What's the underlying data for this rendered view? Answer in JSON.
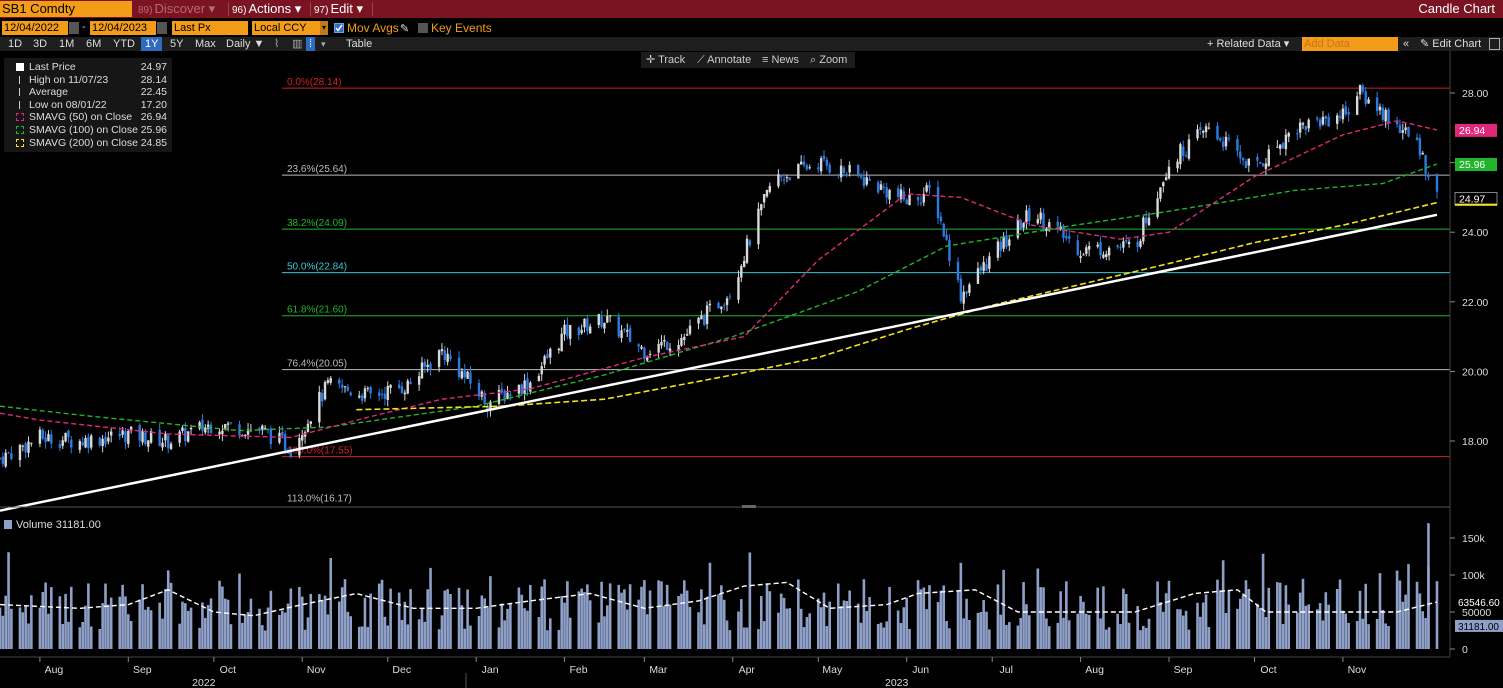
{
  "header": {
    "ticker": "SB1 Comdty",
    "discover": {
      "num": "89)",
      "label": "Discover"
    },
    "actions": {
      "num": "96)",
      "label": "Actions"
    },
    "edit": {
      "num": "97)",
      "label": "Edit"
    },
    "title": "Candle Chart"
  },
  "controls": {
    "start_date": "12/04/2022",
    "end_date": "12/04/2023",
    "field": "Last Px",
    "currency": "Local CCY",
    "mov_avgs": "Mov Avgs",
    "key_events": "Key Events"
  },
  "periods": [
    "1D",
    "3D",
    "1M",
    "6M",
    "YTD",
    "1Y",
    "5Y",
    "Max"
  ],
  "selected_period": "1Y",
  "frequency": "Daily",
  "table_label": "Table",
  "related_data": "Related Data",
  "add_data_placeholder": "Add Data",
  "edit_chart": "Edit Chart",
  "tools": {
    "track": "Track",
    "annotate": "Annotate",
    "news": "News",
    "zoom": "Zoom"
  },
  "legend": [
    {
      "label": "Last Price",
      "value": "24.97",
      "color": "#ffffff"
    },
    {
      "label": "High on 11/07/23",
      "value": "28.14",
      "color": "#cccccc"
    },
    {
      "label": "Average",
      "value": "22.45",
      "color": "#cccccc"
    },
    {
      "label": "Low on 08/01/22",
      "value": "17.20",
      "color": "#cccccc"
    },
    {
      "label": "SMAVG (50)  on Close",
      "value": "26.94",
      "color": "#e0287a"
    },
    {
      "label": "SMAVG (100)  on Close",
      "value": "25.96",
      "color": "#21b32a"
    },
    {
      "label": "SMAVG (200)  on Close",
      "value": "24.85",
      "color": "#f2e21a"
    }
  ],
  "volume_legend": "Volume 31181.00",
  "colors": {
    "up": "#d9d9d9",
    "down": "#2d7be0",
    "sma50": "#e0287a",
    "sma100": "#21b32a",
    "sma200": "#f2e21a",
    "accent": "#f29c1a",
    "header": "#7a1422"
  },
  "chart_data": [
    {
      "type": "candlestick",
      "title": "SB1 Comdty",
      "ylim": [
        16,
        28.7
      ],
      "yticks": [
        18.0,
        20.0,
        22.0,
        24.0,
        26.0,
        28.0
      ],
      "ytick_labels": [
        "18.00",
        "20.00",
        "22.00",
        "24.00",
        "26.00",
        "28.00"
      ],
      "x_range": [
        "2022-07-18",
        "2023-12-04"
      ],
      "months": [
        {
          "label": "Aug",
          "date": "2022-08-01"
        },
        {
          "label": "Sep",
          "date": "2022-09-01"
        },
        {
          "label": "Oct",
          "date": "2022-10-01"
        },
        {
          "label": "Nov",
          "date": "2022-11-01"
        },
        {
          "label": "Dec",
          "date": "2022-12-01"
        },
        {
          "label": "Jan",
          "date": "2023-01-01"
        },
        {
          "label": "Feb",
          "date": "2023-02-01"
        },
        {
          "label": "Mar",
          "date": "2023-03-01"
        },
        {
          "label": "Apr",
          "date": "2023-04-01"
        },
        {
          "label": "May",
          "date": "2023-05-01"
        },
        {
          "label": "Jun",
          "date": "2023-06-01"
        },
        {
          "label": "Jul",
          "date": "2023-07-01"
        },
        {
          "label": "Aug",
          "date": "2023-08-01"
        },
        {
          "label": "Sep",
          "date": "2023-09-01"
        },
        {
          "label": "Oct",
          "date": "2023-10-01"
        },
        {
          "label": "Nov",
          "date": "2023-11-01"
        }
      ],
      "years": [
        {
          "label": "2022",
          "date": "2022-10-01"
        },
        {
          "label": "2023",
          "date": "2023-06-01"
        }
      ],
      "close_path": [
        [
          "2022-07-18",
          17.5
        ],
        [
          "2022-08-01",
          18.1
        ],
        [
          "2022-08-15",
          18.0
        ],
        [
          "2022-09-01",
          18.2
        ],
        [
          "2022-09-15",
          18.0
        ],
        [
          "2022-10-01",
          18.5
        ],
        [
          "2022-10-18",
          18.3
        ],
        [
          "2022-10-28",
          17.8
        ],
        [
          "2022-11-10",
          19.6
        ],
        [
          "2022-11-25",
          19.3
        ],
        [
          "2022-12-08",
          19.6
        ],
        [
          "2022-12-20",
          20.6
        ],
        [
          "2023-01-05",
          19.1
        ],
        [
          "2023-01-20",
          19.7
        ],
        [
          "2023-02-01",
          21.1
        ],
        [
          "2023-02-15",
          21.5
        ],
        [
          "2023-03-01",
          20.6
        ],
        [
          "2023-03-15",
          21.0
        ],
        [
          "2023-03-31",
          22.3
        ],
        [
          "2023-04-15",
          25.5
        ],
        [
          "2023-05-01",
          26.0
        ],
        [
          "2023-05-15",
          25.6
        ],
        [
          "2023-06-01",
          24.9
        ],
        [
          "2023-06-10",
          25.2
        ],
        [
          "2023-06-20",
          22.2
        ],
        [
          "2023-07-01",
          23.3
        ],
        [
          "2023-07-15",
          24.6
        ],
        [
          "2023-08-01",
          23.5
        ],
        [
          "2023-08-20",
          23.6
        ],
        [
          "2023-09-01",
          26.0
        ],
        [
          "2023-09-15",
          27.0
        ],
        [
          "2023-10-01",
          25.8
        ],
        [
          "2023-10-15",
          27.0
        ],
        [
          "2023-11-01",
          27.4
        ],
        [
          "2023-11-07",
          28.0
        ],
        [
          "2023-11-20",
          27.1
        ],
        [
          "2023-11-28",
          26.4
        ],
        [
          "2023-12-04",
          24.97
        ]
      ],
      "sma50": [
        [
          "2022-07-18",
          18.8
        ],
        [
          "2022-08-01",
          18.6
        ],
        [
          "2022-09-15",
          18.2
        ],
        [
          "2022-10-28",
          18.1
        ],
        [
          "2022-11-25",
          18.7
        ],
        [
          "2022-12-20",
          19.2
        ],
        [
          "2023-01-20",
          19.5
        ],
        [
          "2023-03-01",
          20.4
        ],
        [
          "2023-04-05",
          21.0
        ],
        [
          "2023-05-01",
          23.2
        ],
        [
          "2023-06-01",
          25.1
        ],
        [
          "2023-06-20",
          25.0
        ],
        [
          "2023-07-15",
          24.2
        ],
        [
          "2023-08-15",
          23.8
        ],
        [
          "2023-09-01",
          24.0
        ],
        [
          "2023-10-01",
          25.6
        ],
        [
          "2023-11-01",
          26.8
        ],
        [
          "2023-11-20",
          27.2
        ],
        [
          "2023-12-04",
          26.94
        ]
      ],
      "sma100": [
        [
          "2022-07-18",
          19.0
        ],
        [
          "2022-08-20",
          18.7
        ],
        [
          "2022-10-10",
          18.3
        ],
        [
          "2022-11-10",
          18.4
        ],
        [
          "2023-01-01",
          19.0
        ],
        [
          "2023-02-15",
          19.9
        ],
        [
          "2023-04-01",
          21.0
        ],
        [
          "2023-05-15",
          22.3
        ],
        [
          "2023-06-15",
          23.6
        ],
        [
          "2023-07-30",
          24.2
        ],
        [
          "2023-09-01",
          24.6
        ],
        [
          "2023-10-15",
          25.2
        ],
        [
          "2023-11-15",
          25.4
        ],
        [
          "2023-12-04",
          25.96
        ]
      ],
      "sma200": [
        [
          "2022-11-20",
          18.9
        ],
        [
          "2023-01-10",
          19.0
        ],
        [
          "2023-02-15",
          19.2
        ],
        [
          "2023-04-01",
          19.9
        ],
        [
          "2023-05-01",
          20.4
        ],
        [
          "2023-06-01",
          21.2
        ],
        [
          "2023-07-01",
          21.9
        ],
        [
          "2023-08-01",
          22.5
        ],
        [
          "2023-09-01",
          23.1
        ],
        [
          "2023-10-01",
          23.7
        ],
        [
          "2023-11-01",
          24.2
        ],
        [
          "2023-12-04",
          24.85
        ]
      ],
      "trendline": [
        [
          "2022-07-18",
          16.0
        ],
        [
          "2023-12-04",
          24.5
        ]
      ],
      "fib_levels": [
        {
          "label": "0.0%(28.14)",
          "value": 28.14,
          "color": "#d2202b"
        },
        {
          "label": "23.6%(25.64)",
          "value": 25.64,
          "color": "#bbbbbb"
        },
        {
          "label": "38.2%(24.09)",
          "value": 24.09,
          "color": "#21b32a"
        },
        {
          "label": "50.0%(22.84)",
          "value": 22.84,
          "color": "#3cc6d6"
        },
        {
          "label": "61.8%(21.60)",
          "value": 21.6,
          "color": "#21b32a"
        },
        {
          "label": "76.4%(20.05)",
          "value": 20.05,
          "color": "#bbbbbb"
        },
        {
          "label": "100.0%(17.55)",
          "value": 17.55,
          "color": "#d2202b"
        },
        {
          "label": "113.0%(16.17)",
          "value": 16.17,
          "color": "#bbbbbb"
        }
      ],
      "last_labels": [
        {
          "label": "26.94",
          "value": 26.94,
          "bg": "#e0287a",
          "fg": "#ffffff"
        },
        {
          "label": "25.96",
          "value": 25.96,
          "bg": "#21b32a",
          "fg": "#ffffff"
        },
        {
          "label": "24.97",
          "value": 24.97,
          "bg": "#000000",
          "fg": "#ffffff"
        }
      ]
    },
    {
      "type": "bar",
      "title": "Volume",
      "ylim": [
        0,
        180000
      ],
      "yticks": [
        0,
        50000,
        100000,
        150000
      ],
      "ytick_labels": [
        "0",
        "50000",
        "100k",
        "150k"
      ],
      "avg_path": [
        [
          "2022-07-18",
          60000
        ],
        [
          "2022-08-15",
          55000
        ],
        [
          "2022-09-01",
          60000
        ],
        [
          "2022-09-15",
          80000
        ],
        [
          "2022-10-01",
          50000
        ],
        [
          "2022-10-15",
          45000
        ],
        [
          "2022-11-01",
          60000
        ],
        [
          "2022-11-20",
          75000
        ],
        [
          "2022-12-10",
          55000
        ],
        [
          "2023-01-01",
          55000
        ],
        [
          "2023-01-20",
          65000
        ],
        [
          "2023-02-10",
          75000
        ],
        [
          "2023-03-01",
          55000
        ],
        [
          "2023-03-20",
          65000
        ],
        [
          "2023-04-05",
          85000
        ],
        [
          "2023-04-20",
          90000
        ],
        [
          "2023-05-05",
          55000
        ],
        [
          "2023-05-25",
          60000
        ],
        [
          "2023-06-05",
          75000
        ],
        [
          "2023-06-25",
          80000
        ],
        [
          "2023-07-10",
          50000
        ],
        [
          "2023-08-01",
          50000
        ],
        [
          "2023-08-20",
          50000
        ],
        [
          "2023-09-10",
          75000
        ],
        [
          "2023-09-25",
          80000
        ],
        [
          "2023-10-05",
          50000
        ],
        [
          "2023-11-01",
          50000
        ],
        [
          "2023-11-20",
          50000
        ],
        [
          "2023-12-04",
          63546
        ]
      ],
      "last_labels": [
        {
          "label": "63546.60",
          "value": 63546,
          "bg": "#000000",
          "fg": "#ffffff"
        },
        {
          "label": "31181.00",
          "value": 31181,
          "bg": "#8ea0c8",
          "fg": "#000000"
        }
      ],
      "last_value": 31181
    }
  ]
}
